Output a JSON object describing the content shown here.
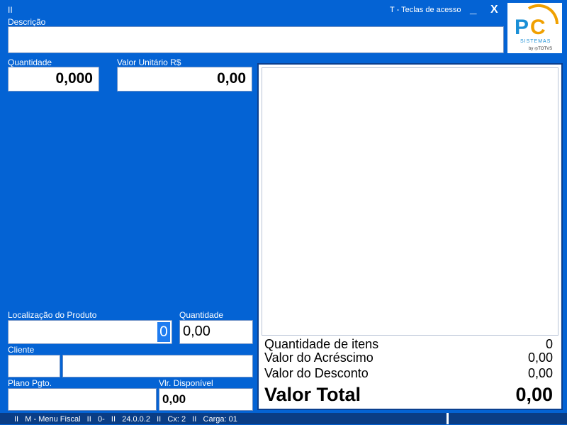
{
  "header": {
    "separator": "II",
    "access_keys": "T - Teclas de acesso",
    "minimize": "_",
    "close": "X"
  },
  "logo": {
    "brand": "PC",
    "sub": "SISTEMAS",
    "by": "by TOTVS"
  },
  "descricao": {
    "label": "Descrição",
    "value": ""
  },
  "quantidade": {
    "label": "Quantidade",
    "value": "0,000"
  },
  "valor_unitario": {
    "label": "Valor Unitário R$",
    "value": "0,00"
  },
  "localizacao": {
    "label": "Localização do Produto",
    "value": "0"
  },
  "quantidade2": {
    "label": "Quantidade",
    "value": "0,00"
  },
  "cliente": {
    "label": "Cliente",
    "code": "",
    "name": ""
  },
  "plano": {
    "label": "Plano Pgto.",
    "value": ""
  },
  "vlr_disponivel": {
    "label": "Vlr. Disponível",
    "value": "0,00"
  },
  "summary": {
    "qtd_itens_label": "Quantidade de itens",
    "qtd_itens_value": "0",
    "acrescimo_label": "Valor do Acréscimo",
    "acrescimo_value": "0,00",
    "desconto_label": "Valor do Desconto",
    "desconto_value": "0,00",
    "total_label": "Valor Total",
    "total_value": "0,00"
  },
  "status": {
    "text": "II   M - Menu Fiscal   II   0-   II   24.0.0.2   II   Cx: 2   II   Carga: 01"
  }
}
